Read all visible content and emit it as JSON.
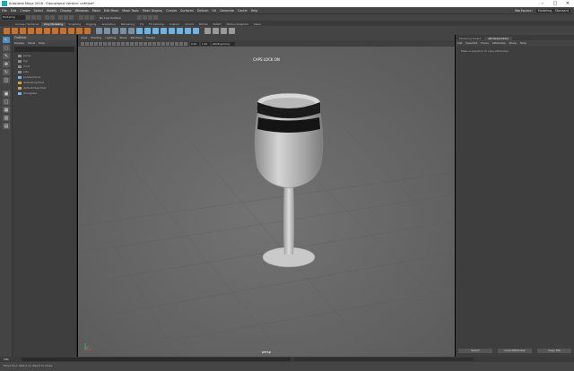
{
  "title": "Autodesk Maya 2018 - Educational Version: untitled*",
  "menus": [
    "File",
    "Edit",
    "Create",
    "Select",
    "Modify",
    "Display",
    "Windows",
    "Mesh",
    "Edit Mesh",
    "Mesh Tools",
    "Mesh Display",
    "Curves",
    "Surfaces",
    "Deform",
    "UV",
    "Generate",
    "Cache",
    "Help"
  ],
  "workspace": {
    "label": "Workspace:",
    "value": "Modeling - Standard"
  },
  "menuset": "Modeling",
  "live_surface": "No Live Surface",
  "shelf_tabs": [
    "Curves / Surfaces",
    "Poly Modeling",
    "Sculpting",
    "Rigging",
    "Animation",
    "Rendering",
    "FX",
    "FX Caching",
    "Custom",
    "Arnold",
    "Bifrost",
    "MASH",
    "Motion Graphics",
    "XGen"
  ],
  "active_shelf_tab": "Poly Modeling",
  "outliner": {
    "title": "Outliner",
    "menu": [
      "Display",
      "Show",
      "Help"
    ],
    "items": [
      {
        "label": "persp",
        "type": "camera"
      },
      {
        "label": "top",
        "type": "camera"
      },
      {
        "label": "front",
        "type": "camera"
      },
      {
        "label": "side",
        "type": "camera"
      },
      {
        "label": "polySurface1",
        "type": "mesh"
      },
      {
        "label": "defaultLightSet",
        "type": "set"
      },
      {
        "label": "defaultObjectSet",
        "type": "set"
      },
      {
        "label": "Wineglass",
        "type": "mesh"
      }
    ]
  },
  "viewport": {
    "menu": [
      "View",
      "Shading",
      "Lighting",
      "Show",
      "Renderer",
      "Panels"
    ],
    "hud_top": "CAPS LOCK ON",
    "camera_label": "persp",
    "field_1": "0.00",
    "field_2": "1.00",
    "colorspace": "sRGB gamma"
  },
  "attribute_editor": {
    "tabs": [
      "Modeling Toolkit",
      "Attribute Editor"
    ],
    "active_tab": "Attribute Editor",
    "menu": [
      "List",
      "Selected",
      "Focus",
      "Attributes",
      "Show",
      "Help"
    ],
    "message": "Make a selection to view Attributes",
    "buttons": [
      "Select",
      "Load Attributes",
      "Copy Tab"
    ]
  },
  "command_line": {
    "lang": "MEL"
  },
  "help_line": "Move Tool: Select an object to move.",
  "colors": {
    "accent": "#4d8ec2",
    "maya_logo": "#1fa8b5",
    "viewport_bg": "#6a6a6a",
    "panel_bg": "#444444"
  }
}
